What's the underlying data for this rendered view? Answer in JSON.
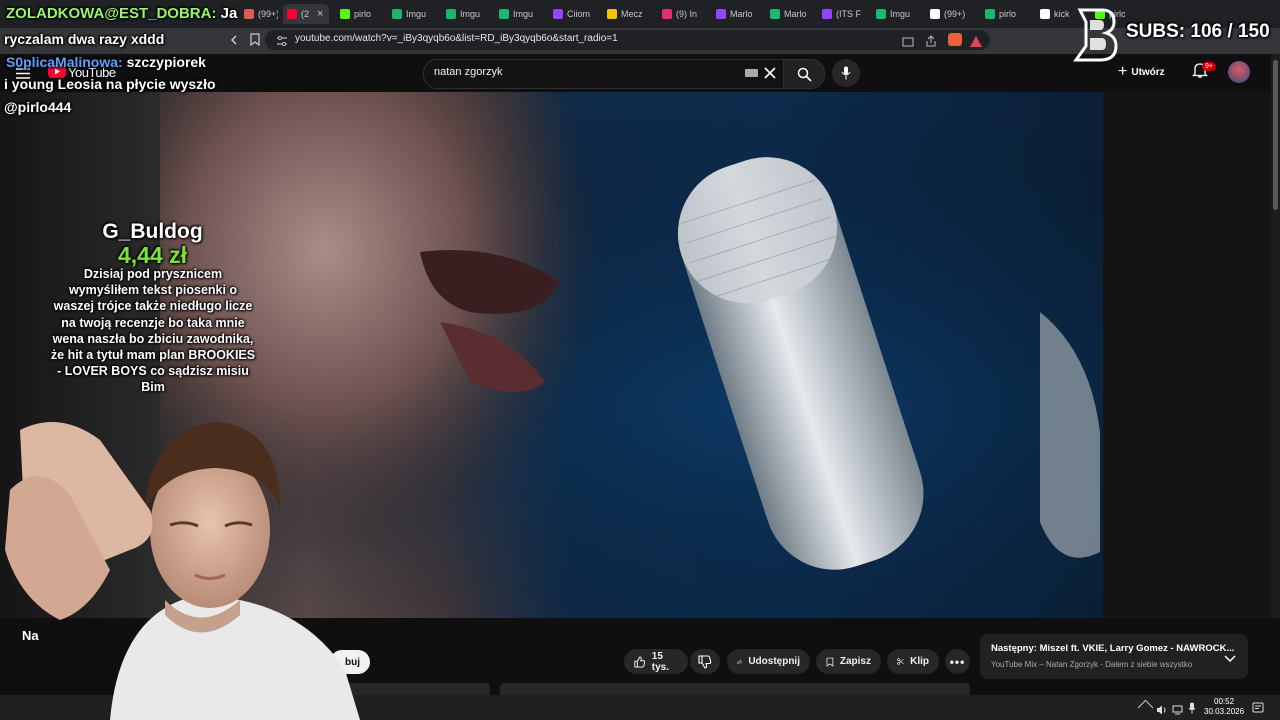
{
  "browser": {
    "tabs": [
      {
        "label": "(99+)",
        "color": "#e05a5a"
      },
      {
        "label": "(2",
        "color": "#ff0033",
        "active": true
      },
      {
        "label": "pirlo",
        "color": "#53fc18"
      },
      {
        "label": "Imgu",
        "color": "#1bb76e"
      },
      {
        "label": "Imgu",
        "color": "#1bb76e"
      },
      {
        "label": "Imgu",
        "color": "#1bb76e"
      },
      {
        "label": "Ciiom",
        "color": "#9146ff"
      },
      {
        "label": "Mecz",
        "color": "#f4c20d"
      },
      {
        "label": "(9) In",
        "color": "#e1306c"
      },
      {
        "label": "Marlo",
        "color": "#9146ff"
      },
      {
        "label": "Marlo",
        "color": "#1bb76e"
      },
      {
        "label": "(ITS F",
        "color": "#9146ff"
      },
      {
        "label": "Imgu",
        "color": "#1bb76e"
      },
      {
        "label": "(99+)",
        "color": "#ffffff"
      },
      {
        "label": "pirlo",
        "color": "#1bb76e"
      },
      {
        "label": "kick",
        "color": "#ffffff"
      },
      {
        "label": "pirlo4",
        "color": "#53fc18"
      }
    ],
    "url": "youtube.com/watch?v=_iBy3qyqb6o&list=RD_iBy3qyqb6o&start_radio=1"
  },
  "youtube": {
    "logo_text": "YouTube",
    "search_value": "natan zgorzyk",
    "create_label": "Utwórz",
    "notif_badge": "9+",
    "title_start": "Na",
    "subscribe_partial": "buj",
    "actions": {
      "likes": "15 tys.",
      "share": "Udostępnij",
      "save": "Zapisz",
      "clip": "Klip"
    },
    "next": {
      "title": "Następny: Miszel ft. VKIE, Larry Gomez - NAWROCK...",
      "subtitle": "YouTube Mix – Natan Zgorzyk - Dalem z siebie wszystko"
    }
  },
  "overlay": {
    "chat": [
      {
        "user": "ZOLADKOWA@EST_DOBRA:",
        "text": "Ja"
      },
      {
        "user": "",
        "text": "ryczalam dwa razy xddd"
      },
      {
        "user": "S0plicaMalinowa:",
        "text": "szczypiorek"
      },
      {
        "user": "",
        "text": "i young Leosia na płycie wyszło"
      },
      {
        "user": "",
        "text": "@pirlo444"
      }
    ],
    "subs_counter": "SUBS: 106 / 150",
    "donation": {
      "donor": "G_Buldog",
      "amount": "4,44 zł",
      "message": "Dzisiaj pod prysznicem wymyśliłem tekst piosenki o waszej trójce także niedługo licze na twoją recenzje bo taka mnie wena naszła bo zbiciu zawodnika, że hit a tytuł mam plan BROOKIES - LOVER BOYS co sądzisz misiu Bim"
    }
  },
  "taskbar": {
    "time": "00:52",
    "date": "30.03.2026"
  }
}
